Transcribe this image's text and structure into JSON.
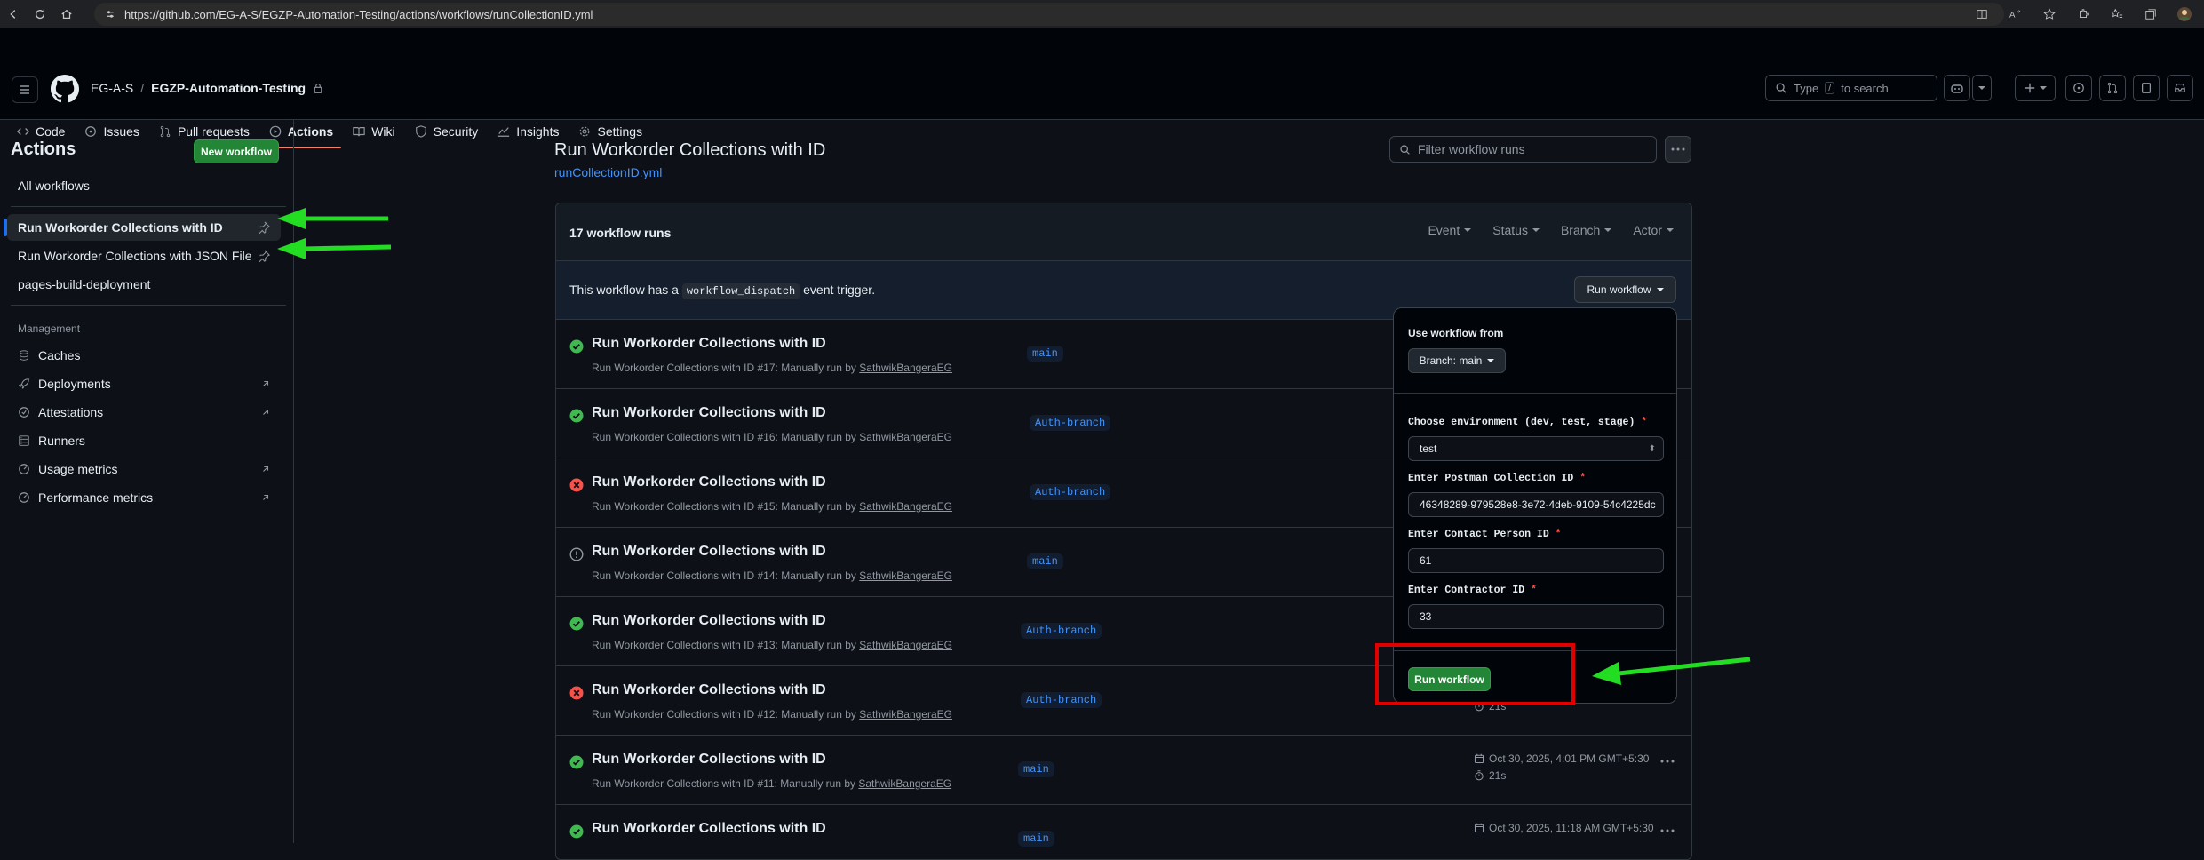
{
  "browser": {
    "url": "https://github.com/EG-A-S/EGZP-Automation-Testing/actions/workflows/runCollectionID.yml"
  },
  "header": {
    "owner": "EG-A-S",
    "separator": "/",
    "repo": "EGZP-Automation-Testing",
    "search_prefix": "Type",
    "search_key": "/",
    "search_suffix": "to search"
  },
  "repo_nav": {
    "tabs": [
      {
        "label": "Code",
        "icon": "code-icon"
      },
      {
        "label": "Issues",
        "icon": "issue-icon"
      },
      {
        "label": "Pull requests",
        "icon": "pull-request-icon"
      },
      {
        "label": "Actions",
        "icon": "play-icon",
        "active": true
      },
      {
        "label": "Wiki",
        "icon": "book-icon"
      },
      {
        "label": "Security",
        "icon": "shield-icon"
      },
      {
        "label": "Insights",
        "icon": "graph-icon"
      },
      {
        "label": "Settings",
        "icon": "gear-icon"
      }
    ]
  },
  "sidebar": {
    "title": "Actions",
    "new_workflow": "New workflow",
    "all_workflows": "All workflows",
    "workflows": [
      {
        "label": "Run Workorder Collections with ID",
        "active": true
      },
      {
        "label": "Run Workorder Collections with JSON File"
      },
      {
        "label": "pages-build-deployment"
      }
    ],
    "management_label": "Management",
    "management": [
      {
        "label": "Caches",
        "icon": "database-icon"
      },
      {
        "label": "Deployments",
        "icon": "rocket-icon",
        "external": true
      },
      {
        "label": "Attestations",
        "icon": "verified-icon",
        "external": true
      },
      {
        "label": "Runners",
        "icon": "server-icon"
      },
      {
        "label": "Usage metrics",
        "icon": "meter-icon",
        "external": true
      },
      {
        "label": "Performance metrics",
        "icon": "meter-icon",
        "external": true
      }
    ]
  },
  "main": {
    "title": "Run Workorder Collections with ID",
    "file_link": "runCollectionID.yml",
    "filter_placeholder": "Filter workflow runs",
    "run_count": "17 workflow runs",
    "filters": [
      "Event",
      "Status",
      "Branch",
      "Actor"
    ],
    "trigger_prefix": "This workflow has a",
    "trigger_code": "workflow_dispatch",
    "trigger_suffix": "event trigger.",
    "run_workflow_button": "Run workflow",
    "runs": [
      {
        "title": "Run Workorder Collections with ID",
        "sub": "Run Workorder Collections with ID #17: Manually run by",
        "user": "SathwikBangeraEG",
        "branch": "main",
        "status": "success",
        "date": "",
        "duration": ""
      },
      {
        "title": "Run Workorder Collections with ID",
        "sub": "Run Workorder Collections with ID #16: Manually run by",
        "user": "SathwikBangeraEG",
        "branch": "Auth-branch",
        "status": "success",
        "date": "",
        "duration": ""
      },
      {
        "title": "Run Workorder Collections with ID",
        "sub": "Run Workorder Collections with ID #15: Manually run by",
        "user": "SathwikBangeraEG",
        "branch": "Auth-branch",
        "status": "failure",
        "date": "",
        "duration": ""
      },
      {
        "title": "Run Workorder Collections with ID",
        "sub": "Run Workorder Collections with ID #14: Manually run by",
        "user": "SathwikBangeraEG",
        "branch": "main",
        "status": "neutral",
        "date": "",
        "duration": ""
      },
      {
        "title": "Run Workorder Collections with ID",
        "sub": "Run Workorder Collections with ID #13: Manually run by",
        "user": "SathwikBangeraEG",
        "branch": "Auth-branch",
        "status": "success",
        "date": "",
        "duration": ""
      },
      {
        "title": "Run Workorder Collections with ID",
        "sub": "Run Workorder Collections with ID #12: Manually run by",
        "user": "SathwikBangeraEG",
        "branch": "Auth-branch",
        "status": "failure",
        "date": "",
        "duration": "21s"
      },
      {
        "title": "Run Workorder Collections with ID",
        "sub": "Run Workorder Collections with ID #11: Manually run by",
        "user": "SathwikBangeraEG",
        "branch": "main",
        "status": "success",
        "date": "Oct 30, 2025, 4:01 PM GMT+5:30",
        "duration": "21s"
      },
      {
        "title": "Run Workorder Collections with ID",
        "sub": "",
        "user": "",
        "branch": "main",
        "status": "success",
        "date": "Oct 30, 2025, 11:18 AM GMT+5:30",
        "duration": ""
      }
    ]
  },
  "dropdown": {
    "use_from_label": "Use workflow from",
    "branch_button": "Branch: main",
    "env_label": "Choose environment (dev, test, stage)",
    "env_value": "test",
    "collection_label": "Enter Postman Collection ID",
    "collection_value": "46348289-979528e8-3e72-4deb-9109-54c4225dc",
    "contact_label": "Enter Contact Person ID",
    "contact_value": "61",
    "contractor_label": "Enter Contractor ID",
    "contractor_value": "33",
    "required_mark": "*",
    "submit": "Run workflow"
  },
  "colors": {
    "success": "#3fb950",
    "failure": "#f85149",
    "neutral": "#9198a1",
    "annotation_arrow": "#22dd22",
    "annotation_box": "#e00000",
    "accent_link": "#4493f8",
    "primary_button": "#238636"
  }
}
